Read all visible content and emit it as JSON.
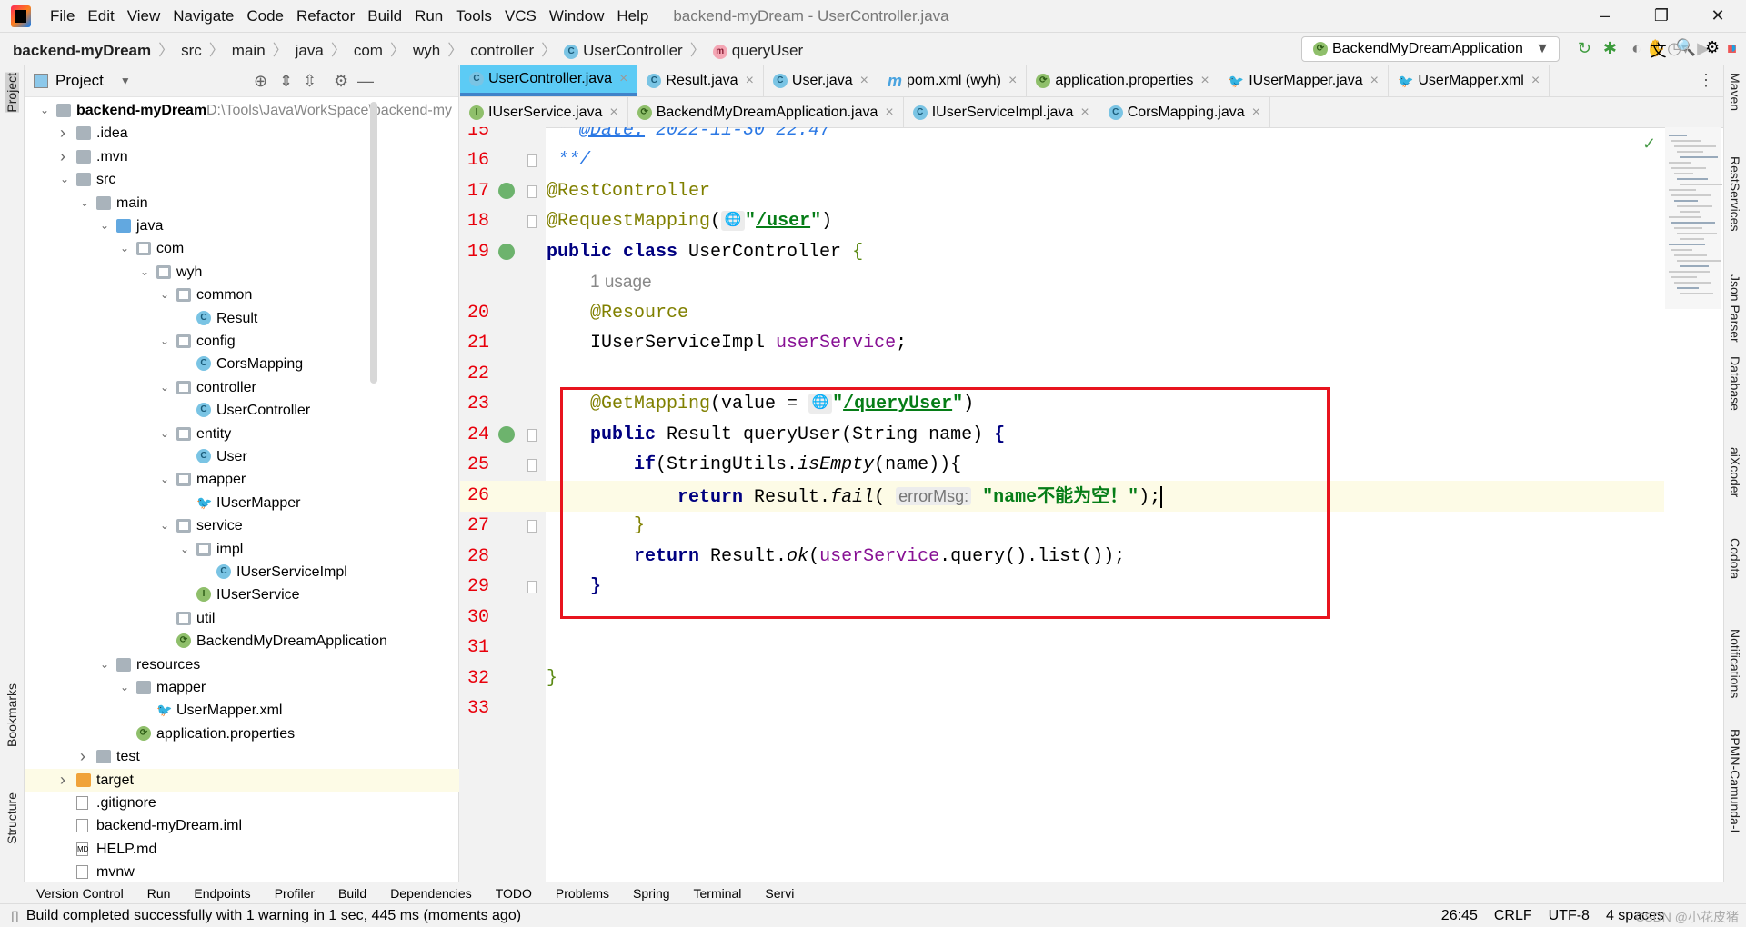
{
  "titlebar": {
    "menus": [
      "File",
      "Edit",
      "View",
      "Navigate",
      "Code",
      "Refactor",
      "Build",
      "Run",
      "Tools",
      "VCS",
      "Window",
      "Help"
    ],
    "title": "backend-myDream - UserController.java",
    "minimize": "–",
    "restore": "❐",
    "close": "✕"
  },
  "breadcrumb": [
    "backend-myDream",
    "src",
    "main",
    "java",
    "com",
    "wyh",
    "controller",
    "UserController",
    "queryUser"
  ],
  "run_config": "BackendMyDreamApplication",
  "left_strip": [
    "Project",
    "Bookmarks",
    "Structure"
  ],
  "project": {
    "title": "Project",
    "root_path": "D:\\Tools\\JavaWorkSpace\\backend-my",
    "tree": [
      {
        "l": 0,
        "t": "backend-myDream",
        "a": "open",
        "i": "module"
      },
      {
        "l": 1,
        "t": ".idea",
        "a": "closed",
        "i": "folder"
      },
      {
        "l": 1,
        "t": ".mvn",
        "a": "closed",
        "i": "folder"
      },
      {
        "l": 1,
        "t": "src",
        "a": "open",
        "i": "folder"
      },
      {
        "l": 2,
        "t": "main",
        "a": "open",
        "i": "folder"
      },
      {
        "l": 3,
        "t": "java",
        "a": "open",
        "i": "folder-blue"
      },
      {
        "l": 4,
        "t": "com",
        "a": "open",
        "i": "package"
      },
      {
        "l": 5,
        "t": "wyh",
        "a": "open",
        "i": "package"
      },
      {
        "l": 6,
        "t": "common",
        "a": "open",
        "i": "package"
      },
      {
        "l": 7,
        "t": "Result",
        "a": "",
        "i": "class"
      },
      {
        "l": 6,
        "t": "config",
        "a": "open",
        "i": "package"
      },
      {
        "l": 7,
        "t": "CorsMapping",
        "a": "",
        "i": "class"
      },
      {
        "l": 6,
        "t": "controller",
        "a": "open",
        "i": "package"
      },
      {
        "l": 7,
        "t": "UserController",
        "a": "",
        "i": "class"
      },
      {
        "l": 6,
        "t": "entity",
        "a": "open",
        "i": "package"
      },
      {
        "l": 7,
        "t": "User",
        "a": "",
        "i": "class"
      },
      {
        "l": 6,
        "t": "mapper",
        "a": "open",
        "i": "package"
      },
      {
        "l": 7,
        "t": "IUserMapper",
        "a": "",
        "i": "mybatis"
      },
      {
        "l": 6,
        "t": "service",
        "a": "open",
        "i": "package"
      },
      {
        "l": 7,
        "t": "impl",
        "a": "open",
        "i": "package"
      },
      {
        "l": 8,
        "t": "IUserServiceImpl",
        "a": "",
        "i": "class"
      },
      {
        "l": 7,
        "t": "IUserService",
        "a": "",
        "i": "interface"
      },
      {
        "l": 6,
        "t": "util",
        "a": "",
        "i": "package"
      },
      {
        "l": 6,
        "t": "BackendMyDreamApplication",
        "a": "",
        "i": "spring"
      },
      {
        "l": 3,
        "t": "resources",
        "a": "open",
        "i": "folder"
      },
      {
        "l": 4,
        "t": "mapper",
        "a": "open",
        "i": "folder"
      },
      {
        "l": 5,
        "t": "UserMapper.xml",
        "a": "",
        "i": "mybatis"
      },
      {
        "l": 4,
        "t": "application.properties",
        "a": "",
        "i": "spring"
      },
      {
        "l": 2,
        "t": "test",
        "a": "closed",
        "i": "folder"
      },
      {
        "l": 1,
        "t": "target",
        "a": "closed",
        "i": "folder-orange",
        "sel": true
      },
      {
        "l": 1,
        "t": ".gitignore",
        "a": "",
        "i": "file"
      },
      {
        "l": 1,
        "t": "backend-myDream.iml",
        "a": "",
        "i": "file"
      },
      {
        "l": 1,
        "t": "HELP.md",
        "a": "",
        "i": "md"
      },
      {
        "l": 1,
        "t": "mvnw",
        "a": "",
        "i": "file"
      }
    ]
  },
  "tabs_row1": [
    {
      "t": "UserController.java",
      "i": "class",
      "active": true
    },
    {
      "t": "Result.java",
      "i": "class"
    },
    {
      "t": "User.java",
      "i": "class"
    },
    {
      "t": "pom.xml (wyh)",
      "i": "maven"
    },
    {
      "t": "application.properties",
      "i": "spring"
    },
    {
      "t": "IUserMapper.java",
      "i": "mybatis"
    },
    {
      "t": "UserMapper.xml",
      "i": "mybatis"
    }
  ],
  "tabs_row2": [
    {
      "t": "IUserService.java",
      "i": "interface"
    },
    {
      "t": "BackendMyDreamApplication.java",
      "i": "spring"
    },
    {
      "t": "IUserServiceImpl.java",
      "i": "class"
    },
    {
      "t": "CorsMapping.java",
      "i": "class"
    }
  ],
  "code": [
    {
      "n": "15",
      "tok": [
        [
          " * ",
          "dc"
        ],
        [
          "@Date:",
          "dc ul"
        ],
        [
          " 2022-11-30 22:47",
          "dc"
        ]
      ]
    },
    {
      "n": "16",
      "tok": [
        [
          " **/",
          "dc"
        ]
      ]
    },
    {
      "n": "17",
      "tok": [
        [
          "@RestController",
          "an"
        ]
      ]
    },
    {
      "n": "18",
      "tok": [
        [
          "@RequestMapping",
          "an"
        ],
        [
          "(",
          ""
        ],
        [
          "G",
          "globe"
        ],
        [
          "\"",
          "st"
        ],
        [
          "/user",
          "st ul"
        ],
        [
          "\"",
          "st"
        ],
        [
          ")",
          ""
        ]
      ]
    },
    {
      "n": "19",
      "tok": [
        [
          "public class ",
          "kw"
        ],
        [
          "UserController ",
          ""
        ],
        [
          "{",
          "br"
        ]
      ]
    },
    {
      "n": "",
      "tok": [
        [
          "    ",
          ""
        ],
        [
          "1 usage",
          "usage"
        ]
      ]
    },
    {
      "n": "20",
      "tok": [
        [
          "    ",
          ""
        ],
        [
          "@Resource",
          "an"
        ]
      ]
    },
    {
      "n": "21",
      "tok": [
        [
          "    IUserServiceImpl ",
          ""
        ],
        [
          "userService",
          "fd"
        ],
        [
          ";",
          ""
        ]
      ]
    },
    {
      "n": "22",
      "tok": []
    },
    {
      "n": "23",
      "tok": [
        [
          "    ",
          ""
        ],
        [
          "@GetMapping",
          "an"
        ],
        [
          "(value = ",
          ""
        ],
        [
          "G",
          "globe"
        ],
        [
          "\"",
          "st"
        ],
        [
          "/queryUser",
          "st ul"
        ],
        [
          "\"",
          "st"
        ],
        [
          ")",
          ""
        ]
      ]
    },
    {
      "n": "24",
      "tok": [
        [
          "    ",
          ""
        ],
        [
          "public ",
          "kw"
        ],
        [
          "Result queryUser(String name) ",
          ""
        ],
        [
          "{",
          "kw"
        ]
      ]
    },
    {
      "n": "25",
      "tok": [
        [
          "        ",
          ""
        ],
        [
          "if",
          "kw"
        ],
        [
          "(StringUtils.",
          ""
        ],
        [
          "isEmpty",
          "it"
        ],
        [
          "(name)){",
          ""
        ]
      ]
    },
    {
      "n": "26",
      "cur": true,
      "tok": [
        [
          "            ",
          ""
        ],
        [
          "return ",
          "kw"
        ],
        [
          "Result.",
          ""
        ],
        [
          "fail",
          "it"
        ],
        [
          "( ",
          ""
        ],
        [
          "errorMsg:",
          "hint"
        ],
        [
          " \"name不能为空！\"",
          "st"
        ],
        [
          ");",
          ""
        ]
      ]
    },
    {
      "n": "27",
      "tok": [
        [
          "        ",
          ""
        ],
        [
          "}",
          "an"
        ]
      ]
    },
    {
      "n": "28",
      "tok": [
        [
          "        ",
          ""
        ],
        [
          "return ",
          "kw"
        ],
        [
          "Result.",
          ""
        ],
        [
          "ok",
          "it"
        ],
        [
          "(",
          ""
        ],
        [
          "userService",
          "fd"
        ],
        [
          ".query().list());",
          ""
        ]
      ]
    },
    {
      "n": "29",
      "tok": [
        [
          "    ",
          ""
        ],
        [
          "}",
          "kw"
        ]
      ]
    },
    {
      "n": "30",
      "tok": []
    },
    {
      "n": "31",
      "tok": []
    },
    {
      "n": "32",
      "tok": [
        [
          "}",
          "br"
        ]
      ]
    },
    {
      "n": "33",
      "tok": []
    }
  ],
  "right_strip": [
    "Maven",
    "RestServices",
    "Json Parser",
    "Database",
    "aiXcoder",
    "Codota",
    "Notifications",
    "BPMN-Camunda-I"
  ],
  "bottom_tools": [
    "Version Control",
    "Run",
    "Endpoints",
    "Profiler",
    "Build",
    "Dependencies",
    "TODO",
    "Problems",
    "Spring",
    "Terminal",
    "Servi"
  ],
  "status": {
    "message": "Build completed successfully with 1 warning in 1 sec, 445 ms (moments ago)",
    "position": "26:45",
    "line_sep": "CRLF",
    "encoding": "UTF-8",
    "indent": "4 spaces",
    "watermark": "CSDN @小花皮猪"
  },
  "colors": {
    "active_tab": "#5ccbf5",
    "line_number": "#e8000b",
    "highlight_box": "#e8141e",
    "keyword": "#000080",
    "string": "#067d17",
    "annotation": "#808000"
  }
}
